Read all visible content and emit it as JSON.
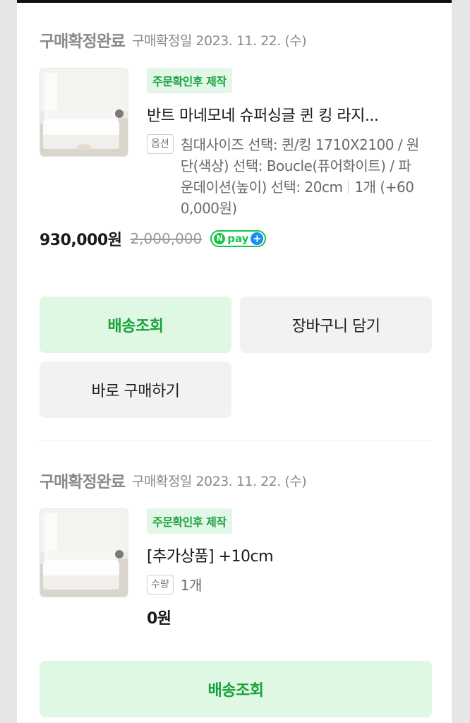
{
  "orders": [
    {
      "status": "구매확정완료",
      "date": "구매확정일 2023. 11. 22. (수)",
      "badge": "주문확인후 제작",
      "product_name": "반트 마네모네 슈퍼싱글 퀸 킹 라지...",
      "option_label": "옵션",
      "option_text": "침대사이즈 선택: 퀸/킹 1710X2100 / 원단(색상) 선택: Boucle(퓨어화이트) / 파운데이션(높이) 선택: 20cm",
      "quantity_text": "1개 (+600,000원)",
      "price": "930,000원",
      "original_price": "2,000,000",
      "npay_text": "pay",
      "buttons": {
        "track": "배송조회",
        "cart": "장바구니 담기",
        "buy": "바로 구매하기"
      }
    },
    {
      "status": "구매확정완료",
      "date": "구매확정일 2023. 11. 22. (수)",
      "badge": "주문확인후 제작",
      "product_name": "[추가상품] +10cm",
      "option_label": "수량",
      "option_text": "1개",
      "price": "0원",
      "buttons": {
        "track": "배송조회"
      }
    }
  ],
  "colors": {
    "accent_green": "#19a23c",
    "badge_bg": "#e2f7e7",
    "npay_green": "#14c445",
    "npay_blue": "#1a8df6"
  }
}
